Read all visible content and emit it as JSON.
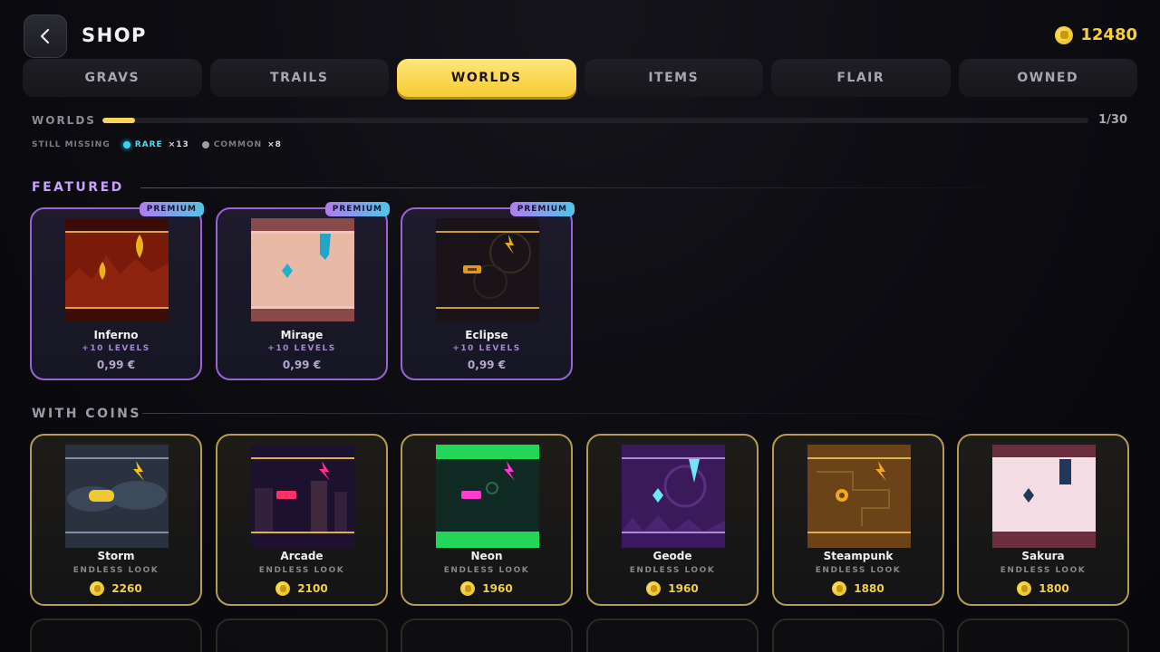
{
  "header": {
    "title": "SHOP",
    "coin_balance": "12480"
  },
  "tabs": [
    {
      "label": "GRAVS",
      "active": false
    },
    {
      "label": "TRAILS",
      "active": false
    },
    {
      "label": "WORLDS",
      "active": true
    },
    {
      "label": "ITEMS",
      "active": false
    },
    {
      "label": "FLAIR",
      "active": false
    },
    {
      "label": "OWNED",
      "active": false
    }
  ],
  "progress": {
    "label": "WORLDS",
    "count_text": "1/30",
    "fraction": 0.033
  },
  "missing": {
    "label": "STILL MISSING",
    "rare_label": "RARE",
    "rare_count": "×13",
    "common_label": "COMMON",
    "common_count": "×8"
  },
  "featured": {
    "title": "FEATURED",
    "items": [
      {
        "name": "Inferno",
        "sub": "+10 LEVELS",
        "price": "0,99 €",
        "badge": "PREMIUM"
      },
      {
        "name": "Mirage",
        "sub": "+10 LEVELS",
        "price": "0,99 €",
        "badge": "PREMIUM"
      },
      {
        "name": "Eclipse",
        "sub": "+10 LEVELS",
        "price": "0,99 €",
        "badge": "PREMIUM"
      }
    ]
  },
  "with_coins": {
    "title": "WITH COINS",
    "items": [
      {
        "name": "Storm",
        "sub": "ENDLESS LOOK",
        "price": "2260"
      },
      {
        "name": "Arcade",
        "sub": "ENDLESS LOOK",
        "price": "2100"
      },
      {
        "name": "Neon",
        "sub": "ENDLESS LOOK",
        "price": "1960"
      },
      {
        "name": "Geode",
        "sub": "ENDLESS LOOK",
        "price": "1960"
      },
      {
        "name": "Steampunk",
        "sub": "ENDLESS LOOK",
        "price": "1880"
      },
      {
        "name": "Sakura",
        "sub": "ENDLESS LOOK",
        "price": "1800"
      }
    ]
  },
  "colors": {
    "accent": "#f6cc33",
    "premium_border": "#9a63d6",
    "coin_border": "#b69c52",
    "rare": "#37d6f4"
  }
}
